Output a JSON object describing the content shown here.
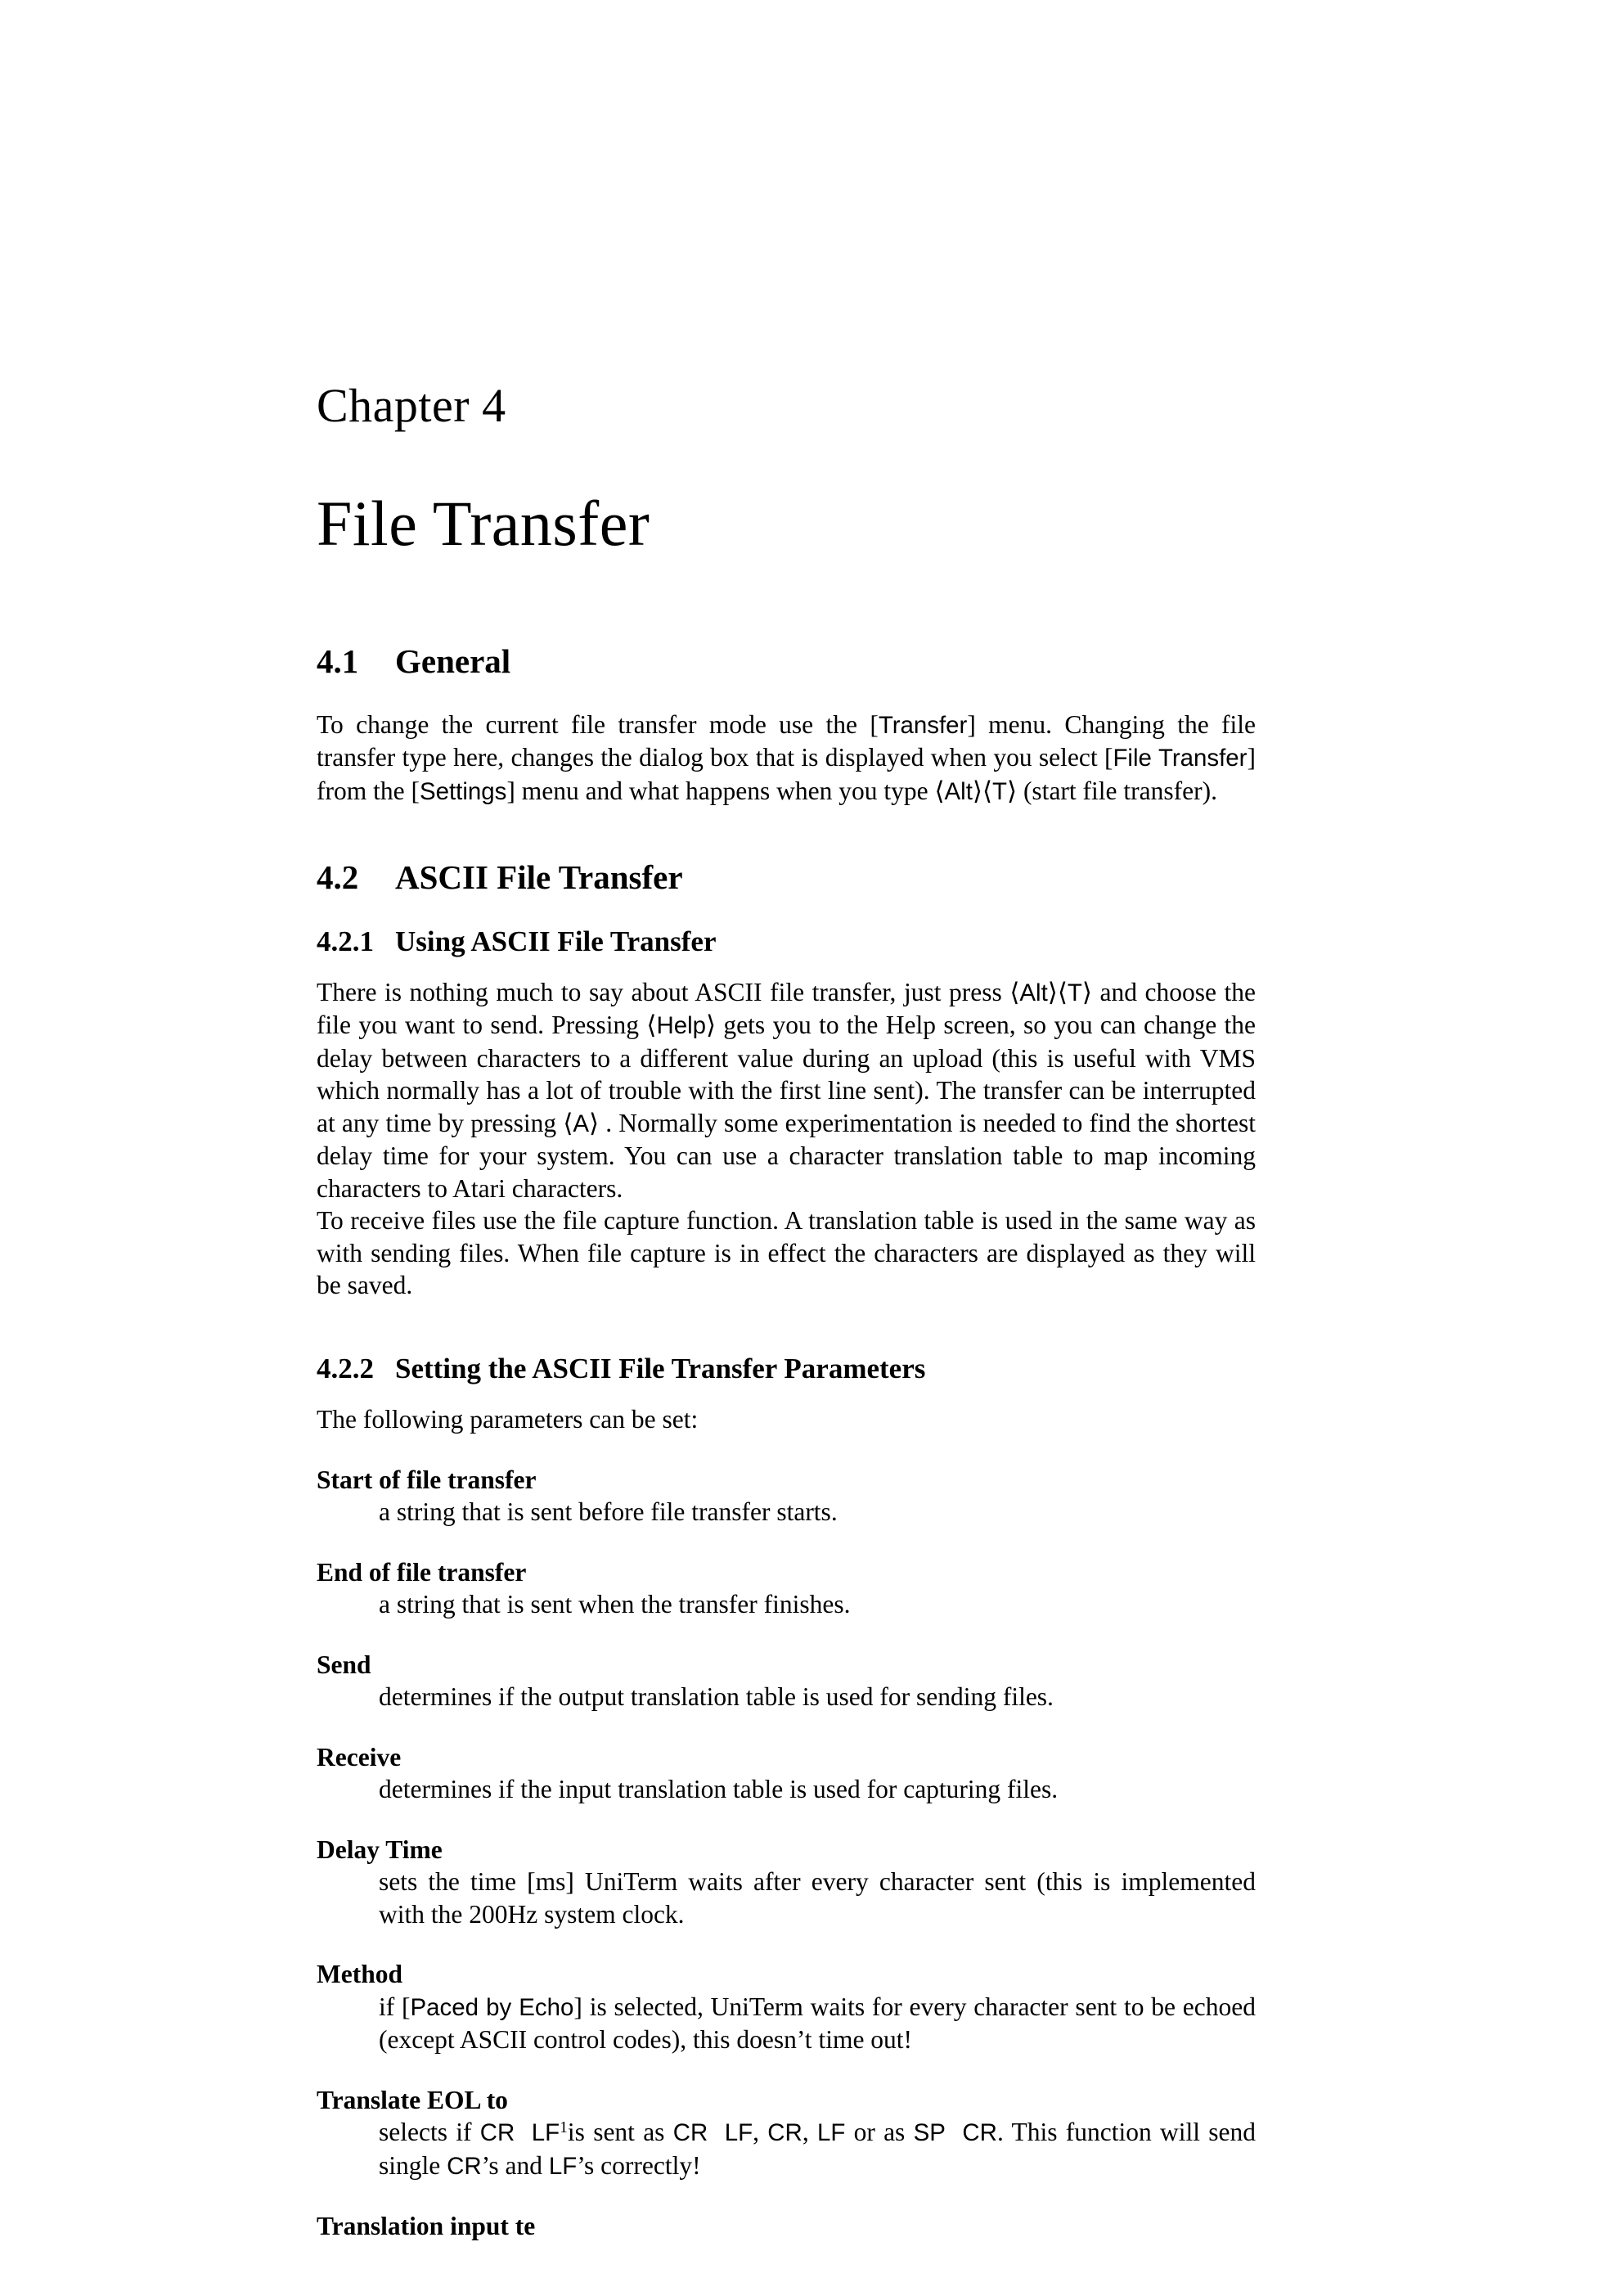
{
  "document": {
    "chapter_number": "Chapter 4",
    "chapter_title": "File Transfer"
  },
  "sections": {
    "s41": {
      "number": "4.1",
      "title": "General",
      "para1": {
        "t1": "To change the current file transfer mode use the [",
        "menu1": "Transfer",
        "t2": "] menu. Changing the file transfer type here, changes the dialog box that is displayed when you select [",
        "menu2": "File Transfer",
        "t3": "] from the [",
        "menu3": "Settings",
        "t4": "] menu and what happens when you type ",
        "key_open1": "⟨",
        "key1": "Alt",
        "key_close1": "⟩",
        "key_open2": "⟨",
        "key2": "T",
        "key_close2": "⟩",
        "t5": " (start file transfer)."
      }
    },
    "s42": {
      "number": "4.2",
      "title": "ASCII File Transfer"
    },
    "s421": {
      "number": "4.2.1",
      "title": "Using ASCII File Transfer",
      "para1": {
        "t1": "There is nothing much to say about ASCII file transfer, just press ",
        "key_open1": "⟨",
        "key1": "Alt",
        "key_close1": "⟩",
        "key_open2": "⟨",
        "key2": "T",
        "key_close2": "⟩",
        "t2": " and choose the file you want to send. Pressing ",
        "key_open3": "⟨",
        "key3": "Help",
        "key_close3": "⟩",
        "t3": " gets you to the Help screen, so you can change the delay between characters to a different value during an upload (this is useful with VMS which normally has a lot of trouble with the first line sent). The transfer can be interrupted at any time by pressing ",
        "key_open4": "⟨",
        "key4": "A",
        "key_close4": "⟩",
        "t4": " . Normally some experimentation is needed to find the shortest delay time for your system. You can use a character translation table to map incoming characters to Atari characters."
      },
      "para2": "To receive files use the file capture function. A translation table is used in the same way as with sending files. When file capture is in effect the characters are displayed as they will be saved."
    },
    "s422": {
      "number": "4.2.2",
      "title": "Setting the ASCII File Transfer Parameters",
      "intro": "The following parameters can be set:",
      "parameters": [
        {
          "term": "Start of file transfer",
          "definition": "a string that is sent before file transfer starts."
        },
        {
          "term": "End of file transfer",
          "definition": "a string that is sent when the transfer finishes."
        },
        {
          "term": "Send",
          "definition": "determines if the output translation table is used for sending files."
        },
        {
          "term": "Receive",
          "definition": "determines if the input translation table is used for capturing files."
        },
        {
          "term": "Delay Time",
          "definition": "sets the time [ms] UniTerm waits after every character sent (this is implemented with the 200Hz system clock."
        },
        {
          "term": "Method",
          "def_t1": "if [",
          "def_menu": "Paced by Echo",
          "def_t2": "] is selected, UniTerm waits for every character sent to be echoed (except ASCII control codes), this doesn’t time out!"
        },
        {
          "term": "Translate EOL to",
          "def_t1": "selects if ",
          "def_k1": "CR",
          "def_k2": "LF",
          "def_fn": "1",
          "def_t2": "is sent as ",
          "def_k3": "CR",
          "def_k4": "LF",
          "def_t3": ", ",
          "def_k5": "CR",
          "def_t4": ", ",
          "def_k6": "LF",
          "def_t5": " or as ",
          "def_k7": "SP",
          "def_k8": "CR",
          "def_t6": ". This function will send single ",
          "def_k9": "CR",
          "def_t7": "’s and ",
          "def_k10": "LF",
          "def_t8": "’s correctly!"
        }
      ],
      "cut_off_term": "Translation input te"
    }
  }
}
